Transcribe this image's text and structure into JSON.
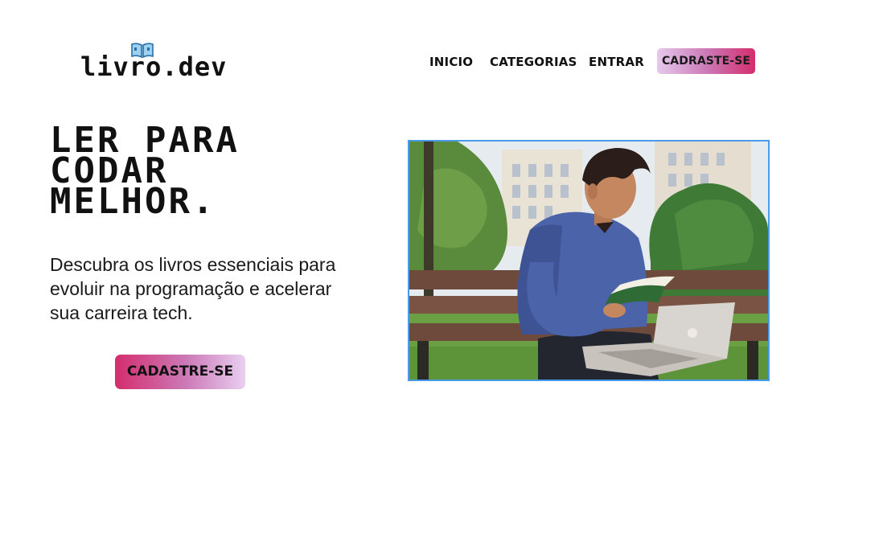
{
  "header": {
    "logo_text": "livro.dev",
    "nav": {
      "inicio": "INICIO",
      "categorias": "CATEGORIAS",
      "entrar": "ENTRAR",
      "cta": "CADRASTE-SE"
    }
  },
  "hero": {
    "title_line1": "LER PARA",
    "title_line2": "CODAR",
    "title_line3": "MELHOR.",
    "description": "Descubra os livros essenciais para evoluir na programação e acelerar sua carreira tech.",
    "cta": "CADASTRE-SE"
  },
  "colors": {
    "gradient_pink": "#d42d6d",
    "gradient_lilac": "#e6c9ec",
    "image_border": "#4a9be8",
    "text": "#111111"
  }
}
